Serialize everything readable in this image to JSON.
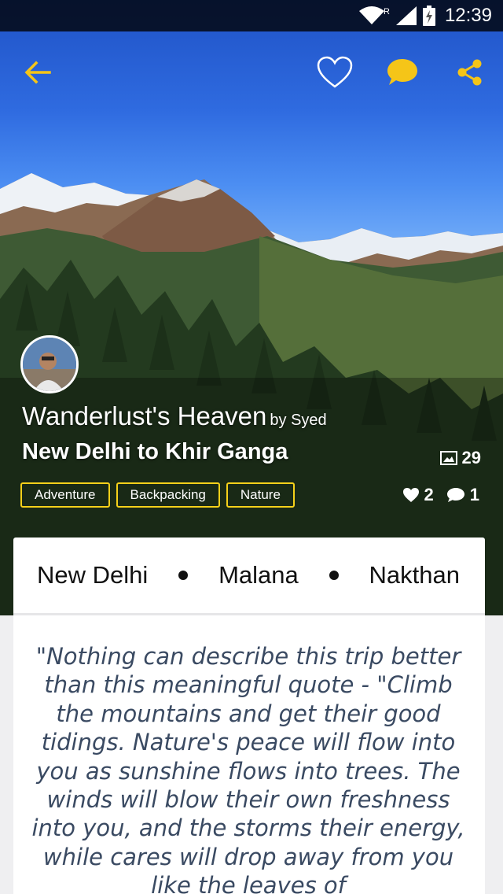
{
  "status_bar": {
    "time": "12:39",
    "network_indicator": "R"
  },
  "toolbar": {
    "back_icon": "arrow-left-icon",
    "like_icon": "heart-outline-icon",
    "comment_icon": "chat-bubble-icon",
    "share_icon": "share-icon",
    "accent_color": "#f5c518"
  },
  "trip": {
    "title": "Wanderlust's Heaven",
    "author": "by Syed",
    "route": "New Delhi to Khir Ganga",
    "photo_count": "29",
    "tags": [
      "Adventure",
      "Backpacking",
      "Nature"
    ],
    "likes": "2",
    "comments": "1"
  },
  "stops": [
    "New Delhi",
    "Malana",
    "Nakthan"
  ],
  "description": "\"Nothing can describe this trip better than this meaningful quote - \"Climb the mountains and get their good tidings. Nature's peace will flow into you as sunshine flows into trees. The winds will blow their own freshness into you, and the storms their energy, while cares will drop away from you like the leaves of",
  "colors": {
    "tag_border": "#f5d01a",
    "quote_text": "#3a4a62"
  }
}
